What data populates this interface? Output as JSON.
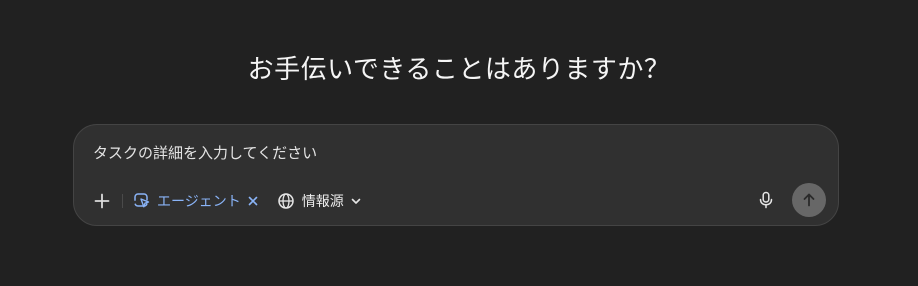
{
  "heading": "お手伝いできることはありますか？",
  "composer": {
    "placeholder": "タスクの詳細を入力してください",
    "value": ""
  },
  "toolbar": {
    "add_icon": "plus-icon",
    "agent_chip": {
      "label": "エージェント",
      "icon": "agent-cursor-icon",
      "remove_icon": "close-icon",
      "color": "#8ab4f8"
    },
    "sources": {
      "label": "情報源",
      "icon": "globe-icon",
      "caret_icon": "chevron-down-icon"
    },
    "mic_icon": "microphone-icon",
    "send_icon": "arrow-up-icon"
  },
  "colors": {
    "background": "#212121",
    "composer": "#303030",
    "send_button": "#676767"
  }
}
